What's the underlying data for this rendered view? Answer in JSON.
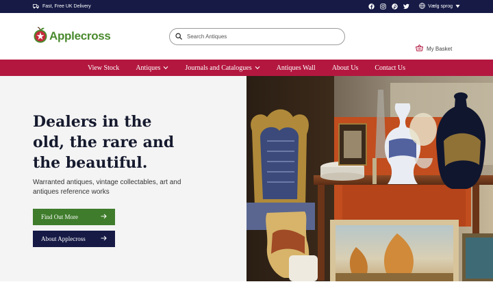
{
  "topbar": {
    "delivery": "Fast, Free UK Delivery",
    "language_label": "Vælg sprog"
  },
  "header": {
    "logo_text": "Applecross",
    "search_placeholder": "Search Antiques",
    "basket_label": "My Basket"
  },
  "nav": {
    "items": [
      {
        "label": "View Stock"
      },
      {
        "label": "Antiques"
      },
      {
        "label": "Journals and Catalogues"
      },
      {
        "label": "Antiques Wall"
      },
      {
        "label": "About Us"
      },
      {
        "label": "Contact Us"
      }
    ]
  },
  "hero": {
    "title_line1": "Dealers in the",
    "title_line2": "old, the rare and",
    "title_line3": "the beautiful.",
    "subtitle": "Warranted antiques, vintage collectables, art and antiques reference works",
    "btn_primary": "Find Out More",
    "btn_secondary": "About Applecross"
  },
  "colors": {
    "topbar": "#161a45",
    "nav": "#b3173f",
    "green": "#3f7c2c",
    "navy": "#161a45",
    "hero_bg": "#f4f4f4"
  }
}
